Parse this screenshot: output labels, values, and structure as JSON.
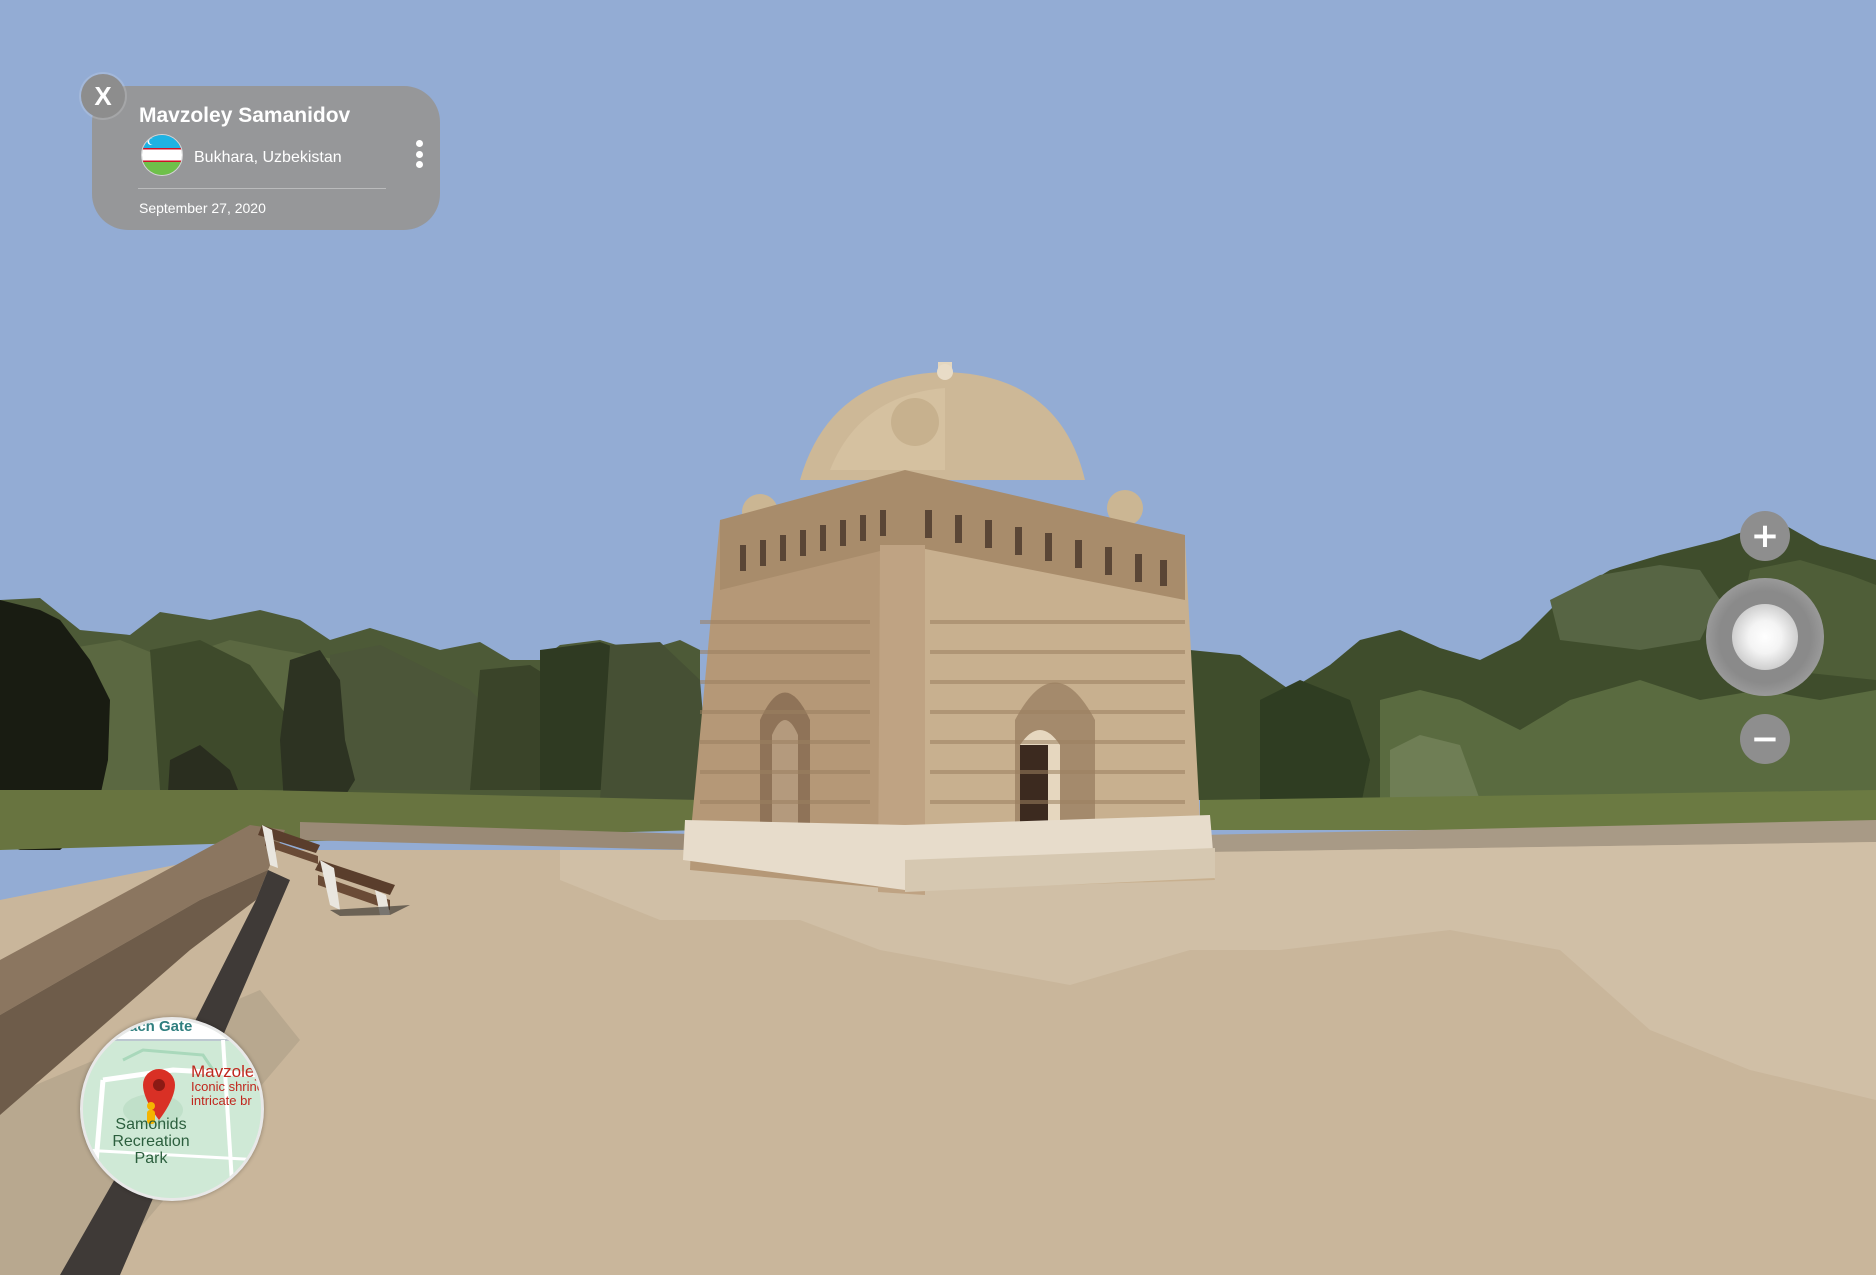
{
  "panorama": {
    "title": "Mavzoley Samanidov",
    "location": "Bukhara, Uzbekistan",
    "date": "September 27, 2020",
    "close_label": "X",
    "flag_label": "Uzbekistan flag"
  },
  "controls": {
    "zoom_in_label": "+",
    "zoom_out_label": "−"
  },
  "minimap": {
    "gate_text": "ach Gate",
    "place_text": "Mavzoley",
    "place_desc": "Iconic shrine intricate br",
    "park_text": "Samonids Recreation Park"
  },
  "colors": {
    "sky": "#93acd4",
    "ground": "#c9b79c",
    "card": "#969696",
    "map_pin": "#d93025"
  },
  "icons": [
    "close-icon",
    "more-vert-icon",
    "plus-icon",
    "minus-icon",
    "compass-icon",
    "map-pin-icon",
    "pegman-icon"
  ]
}
